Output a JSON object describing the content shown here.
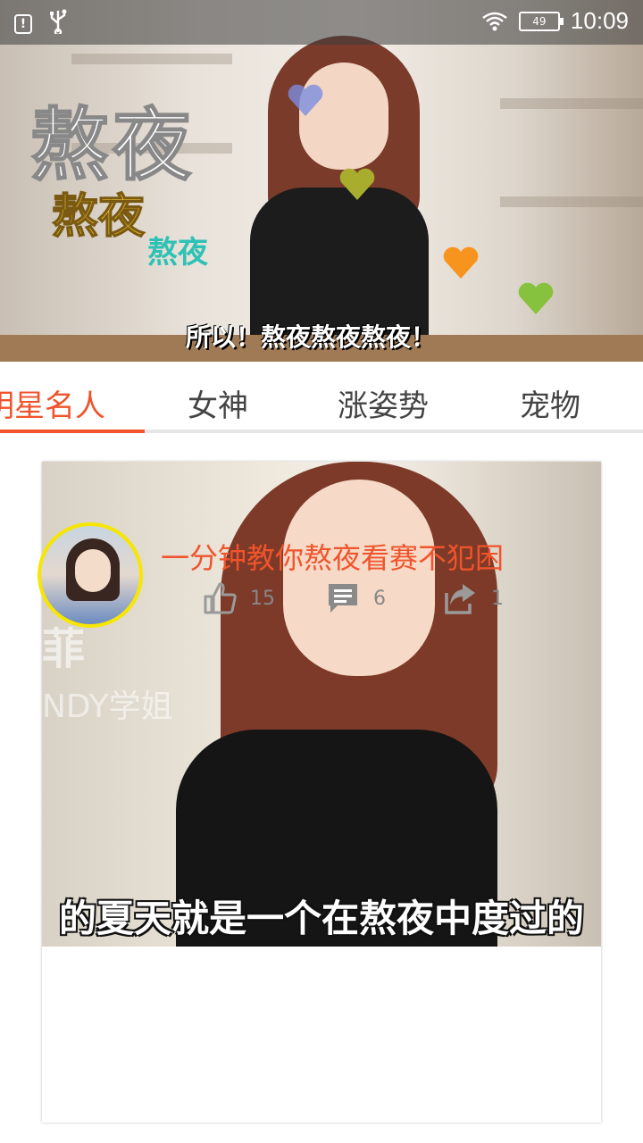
{
  "status_bar": {
    "battery": "49",
    "time": "10:09"
  },
  "banner": {
    "title_large": "熬夜",
    "title_medium": "熬夜",
    "title_small": "熬夜",
    "subtitle": "所以！熬夜熬夜熬夜！"
  },
  "tabs": [
    {
      "label": "明星名人",
      "active": true
    },
    {
      "label": "女神",
      "active": false
    },
    {
      "label": "涨姿势",
      "active": false
    },
    {
      "label": "宠物",
      "active": false
    }
  ],
  "card": {
    "image_caption": "的夏天就是一个在熬夜中度过的",
    "watermark_name": "菲",
    "watermark_sub": "NDY学姐",
    "title": "一分钟教你熬夜看赛不犯困",
    "likes": "15",
    "comments": "6",
    "shares": "1"
  },
  "colors": {
    "accent": "#f0542c",
    "avatar_border": "#f7e600",
    "stat_gray": "#888888"
  },
  "icons": [
    "alert-icon",
    "usb-icon",
    "wifi-icon",
    "battery-icon",
    "heart-icon",
    "thumbs-up-icon",
    "comment-icon",
    "share-icon"
  ]
}
